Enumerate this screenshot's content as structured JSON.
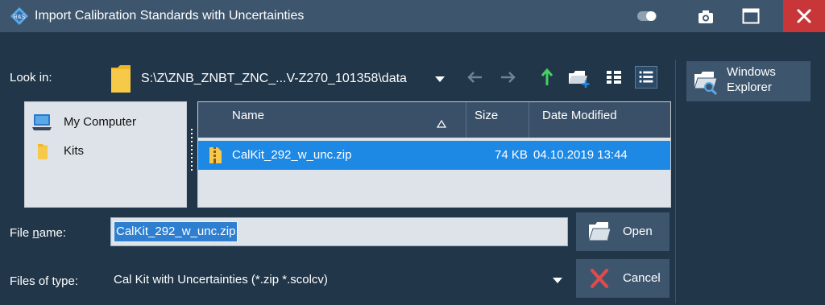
{
  "window": {
    "title": "Import Calibration Standards with Uncertainties",
    "colors": {
      "titlebar": "#3d566e",
      "body": "#213649",
      "close": "#c9363a",
      "selection": "#1e88e5"
    }
  },
  "look_in": {
    "label": "Look in:",
    "path": "S:\\Z\\ZNB_ZNBT_ZNC_...V-Z270_101358\\data",
    "icon": "folder-icon"
  },
  "toolbar": {
    "icons": [
      "back-arrow-icon",
      "forward-arrow-icon",
      "up-arrow-icon",
      "new-folder-icon",
      "list-view-icon",
      "detail-view-icon"
    ]
  },
  "places": [
    {
      "label": "My Computer",
      "icon": "computer-icon"
    },
    {
      "label": "Kits",
      "icon": "folder-icon"
    }
  ],
  "file_list": {
    "columns": [
      "Name",
      "Size",
      "Date Modified"
    ],
    "sort_column": "Name",
    "rows": [
      {
        "name": "CalKit_292_w_unc.zip",
        "size": "74 KB",
        "date": "04.10.2019 13:44",
        "selected": true
      }
    ]
  },
  "file_name": {
    "label_prefix": "File ",
    "label_mnemonic": "n",
    "label_suffix": "ame:",
    "value": "CalKit_292_w_unc.zip"
  },
  "file_type": {
    "label": "Files of type:",
    "value": "Cal Kit with Uncertainties (*.zip *.scolcv)"
  },
  "buttons": {
    "open": "Open",
    "cancel": "Cancel",
    "windows_explorer_line1": "Windows",
    "windows_explorer_line2": "Explorer"
  }
}
